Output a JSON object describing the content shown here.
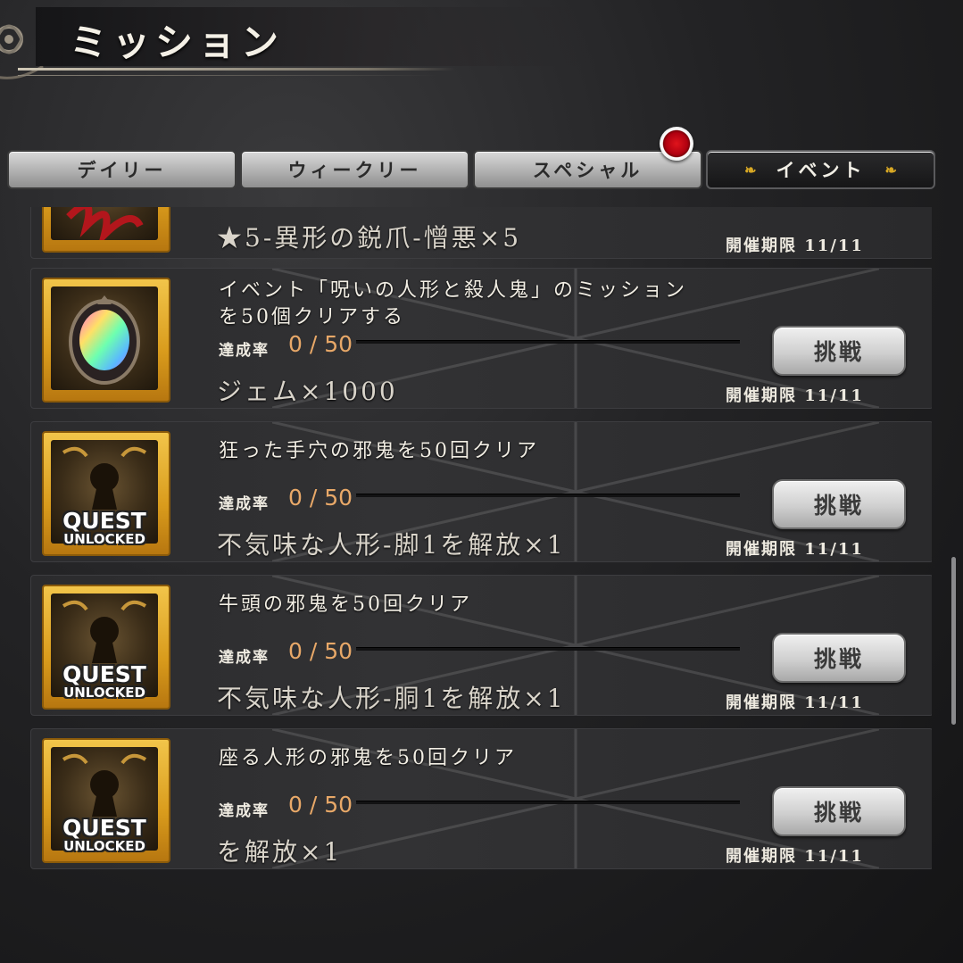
{
  "header": {
    "title": "ミッション"
  },
  "tabs": [
    {
      "label": "デイリー",
      "active": false
    },
    {
      "label": "ウィークリー",
      "active": false
    },
    {
      "label": "スペシャル",
      "active": false,
      "badge": true
    },
    {
      "label": "イベント",
      "active": true
    }
  ],
  "missions": [
    {
      "title": "",
      "progress_label": "",
      "progress_value": "",
      "reward": "★5-異形の鋭爪-憎悪×5",
      "deadline": "開催期限 11/11",
      "button": "",
      "icon": "claw-icon"
    },
    {
      "title_line1": "イベント「呪いの人形と殺人鬼」のミッション",
      "title_line2": "を50個クリアする",
      "progress_label": "達成率",
      "progress_value": "0 / 50",
      "reward": "ジェム×1000",
      "deadline": "開催期限 11/11",
      "button": "挑戦",
      "icon": "rainbow-gem-icon"
    },
    {
      "title_line1": "狂った手穴の邪鬼を50回クリア",
      "progress_label": "達成率",
      "progress_value": "0 / 50",
      "reward": "不気味な人形-脚1を解放×1",
      "deadline": "開催期限 11/11",
      "button": "挑戦",
      "icon": "quest-unlocked-icon",
      "quest1": "QUEST",
      "quest2": "UNLOCKED"
    },
    {
      "title_line1": "牛頭の邪鬼を50回クリア",
      "progress_label": "達成率",
      "progress_value": "0 / 50",
      "reward": "不気味な人形-胴1を解放×1",
      "deadline": "開催期限 11/11",
      "button": "挑戦",
      "icon": "quest-unlocked-icon",
      "quest1": "QUEST",
      "quest2": "UNLOCKED"
    },
    {
      "title_line1": "座る人形の邪鬼を50回クリア",
      "progress_label": "達成率",
      "progress_value": "0 / 50",
      "reward": "を解放×1",
      "deadline": "開催期限 11/11",
      "button": "挑戦",
      "icon": "quest-unlocked-icon",
      "quest1": "QUEST",
      "quest2": "UNLOCKED"
    }
  ],
  "colors": {
    "accent_gold": "#d8a824",
    "progress_orange": "#e8a868",
    "badge_red": "#e0141c"
  }
}
